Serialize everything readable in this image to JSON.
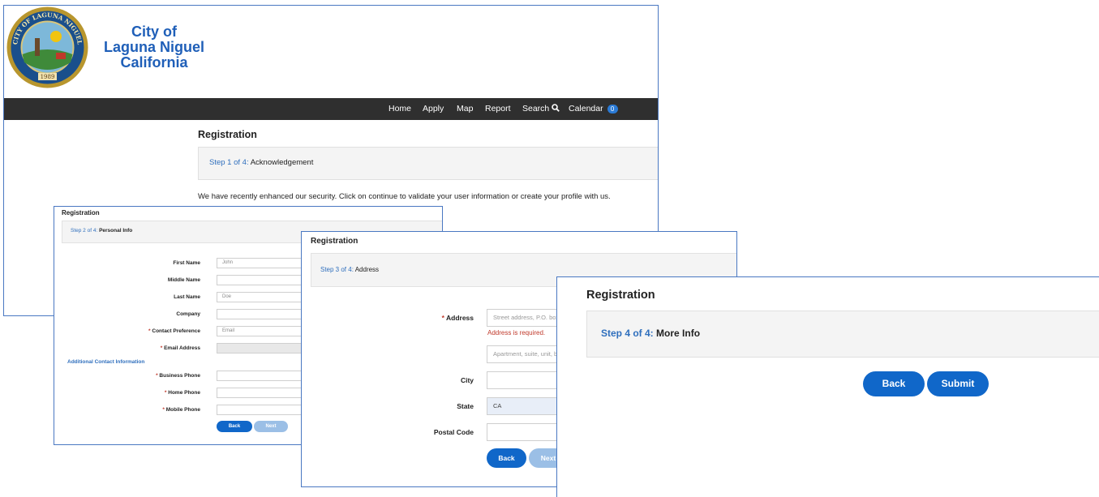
{
  "colors": {
    "brand": "#1f5fb8",
    "primary_button": "#1067c9",
    "disabled_button": "#9bbfe6",
    "nav_bg": "#2f2f2f",
    "error": "#c0392b"
  },
  "panel1": {
    "seal": {
      "text_top": "CITY OF LAGUNA NIGUEL",
      "year": "1989"
    },
    "org_name": {
      "line1": "City of",
      "line2": "Laguna Niguel",
      "line3": "California"
    },
    "nav": {
      "home": "Home",
      "apply": "Apply",
      "map": "Map",
      "report": "Report",
      "search": "Search",
      "calendar": "Calendar",
      "calendar_count": "0"
    },
    "title": "Registration",
    "step_prefix": "Step 1 of 4:",
    "step_name": "Acknowledgement",
    "message": "We have recently enhanced our security. Click on continue to validate your user information or create your profile with us."
  },
  "panel2": {
    "title": "Registration",
    "step_prefix": "Step 2 of 4:",
    "step_name": "Personal Info",
    "fields": {
      "first_name": {
        "label": "First Name",
        "value": "John"
      },
      "middle_name": {
        "label": "Middle Name",
        "value": ""
      },
      "last_name": {
        "label": "Last Name",
        "value": "Doe"
      },
      "company": {
        "label": "Company",
        "value": ""
      },
      "contact_pref": {
        "label": "Contact Preference",
        "value": "Email"
      },
      "email": {
        "label": "Email Address",
        "value": ""
      },
      "business_phone": {
        "label": "Business Phone",
        "value": ""
      },
      "home_phone": {
        "label": "Home Phone",
        "value": ""
      },
      "mobile_phone": {
        "label": "Mobile Phone",
        "value": ""
      }
    },
    "required_marker": "*",
    "additional_contact": "Additional Contact Information",
    "back": "Back",
    "next": "Next"
  },
  "panel3": {
    "title": "Registration",
    "step_prefix": "Step 3 of 4:",
    "step_name": "Address",
    "address_label": "Address",
    "address_placeholder": "Street address, P.O. box",
    "address_error": "Address is required.",
    "address2_placeholder": "Apartment, suite, unit, b",
    "city_label": "City",
    "state_label": "State",
    "state_value": "CA",
    "postal_label": "Postal Code",
    "back": "Back",
    "next": "Next"
  },
  "panel4": {
    "title": "Registration",
    "step_prefix": "Step 4 of 4:",
    "step_name": "More Info",
    "back": "Back",
    "submit": "Submit"
  }
}
